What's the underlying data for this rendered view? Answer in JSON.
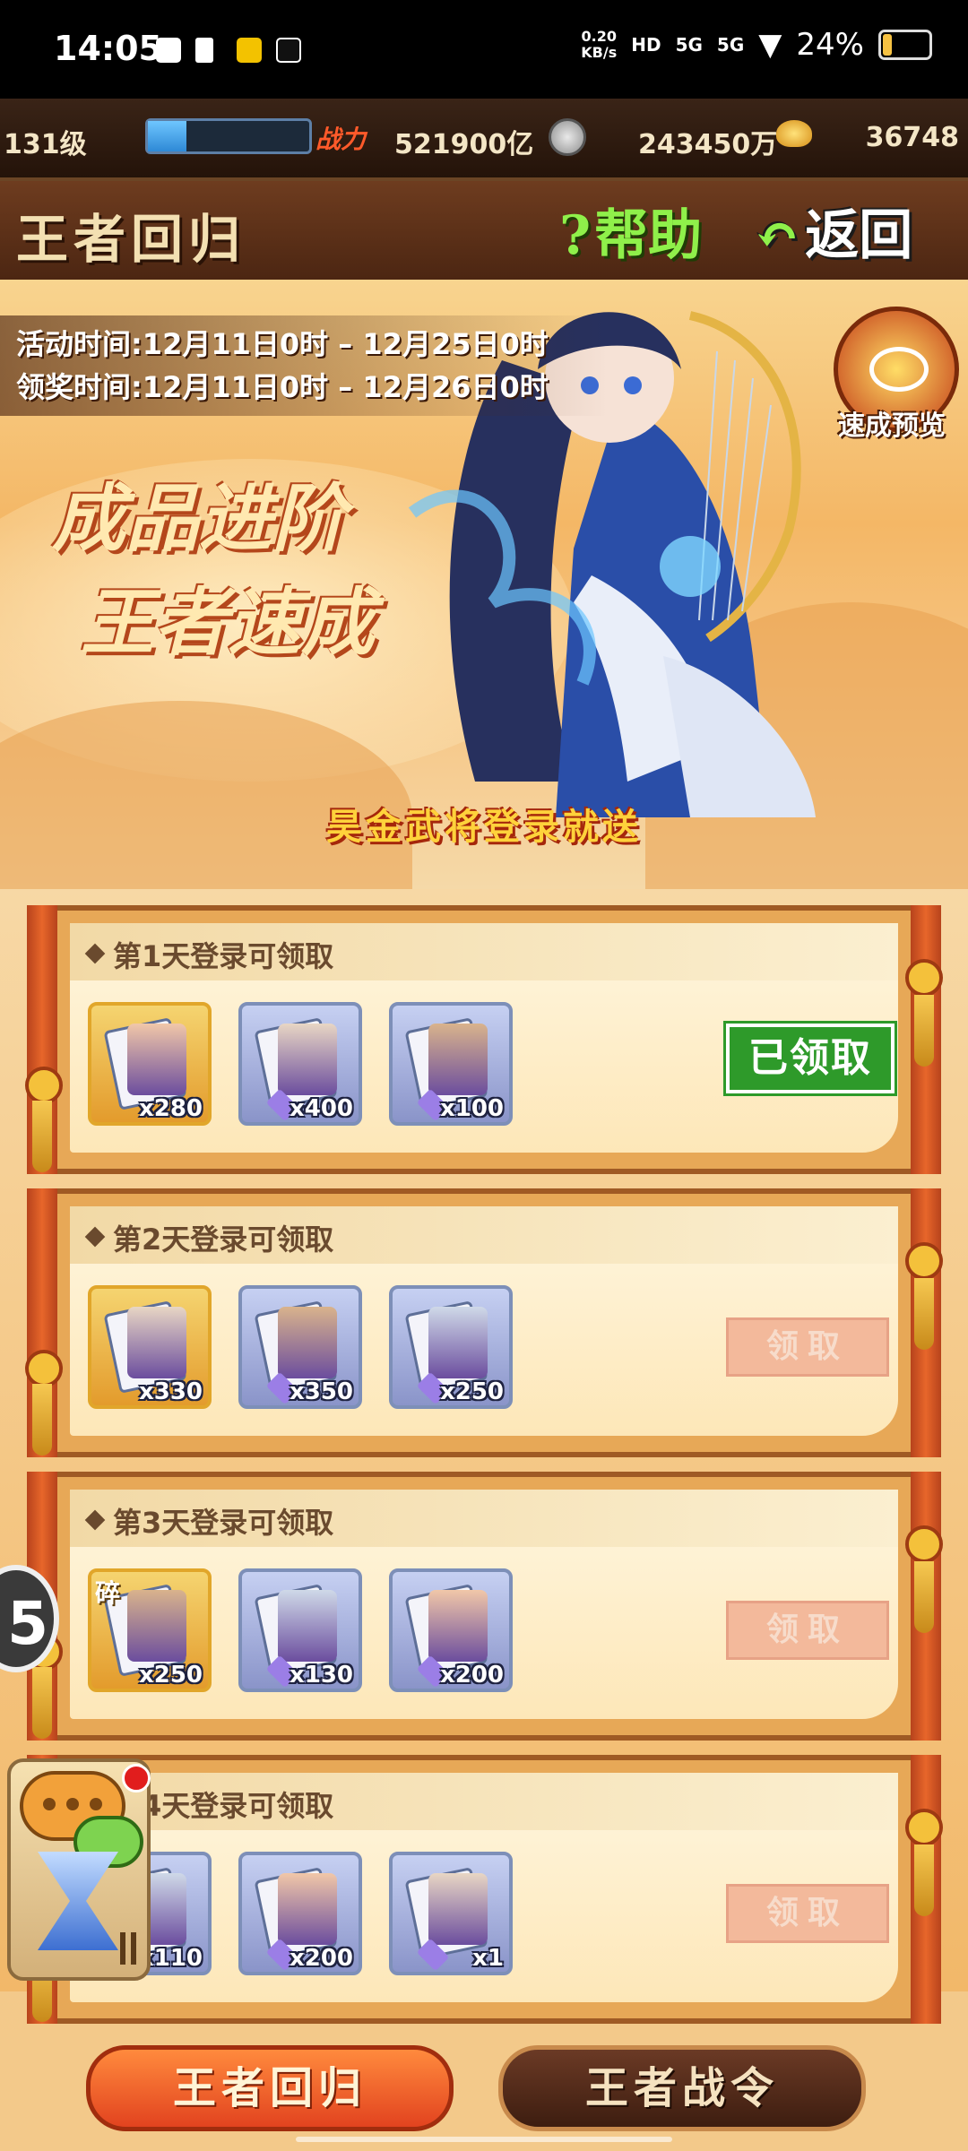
{
  "status_bar": {
    "time": "14:05",
    "speed_value": "0.20",
    "speed_unit": "KB/s",
    "net1": "HD",
    "net2": "5G",
    "net3": "5G",
    "battery": "24%"
  },
  "resources": {
    "level": "131级",
    "power_label": "战力",
    "power_value": "521900亿",
    "silver_value": "243450万",
    "gold_value": "36748",
    "xp_progress": 0.24
  },
  "header": {
    "title": "王者回归",
    "help_label": "帮助",
    "back_label": "返回"
  },
  "banner": {
    "activity_time": "活动时间:12月11日0时 – 12月25日0时",
    "claim_time": "领奖时间:12月11日0时 – 12月26日0时",
    "slogan_line1": "成品进阶",
    "slogan_line2": "王者速成",
    "preview_label": "速成预览",
    "login_send": "昊金武将登录就送"
  },
  "rewards": [
    {
      "title": "第1天登录可领取",
      "items": [
        {
          "count": "x280",
          "type": "gold-hero-card"
        },
        {
          "count": "x400",
          "type": "purple-card"
        },
        {
          "count": "x100",
          "type": "purple-treasure"
        }
      ],
      "button": "已领取",
      "state": "claimed"
    },
    {
      "title": "第2天登录可领取",
      "items": [
        {
          "count": "x330",
          "type": "gold-hero-card"
        },
        {
          "count": "x350",
          "type": "purple-card"
        },
        {
          "count": "x250",
          "type": "purple-card"
        }
      ],
      "button": "领取",
      "state": "locked"
    },
    {
      "title": "第3天登录可领取",
      "items": [
        {
          "count": "x250",
          "type": "gold-hero-fragment",
          "tag": "碎"
        },
        {
          "count": "x130",
          "type": "purple-card"
        },
        {
          "count": "x200",
          "type": "purple-card"
        }
      ],
      "button": "领取",
      "state": "locked"
    },
    {
      "title": "第4天登录可领取",
      "items": [
        {
          "count": "x110",
          "type": "purple-card"
        },
        {
          "count": "x200",
          "type": "purple-card"
        },
        {
          "count": "x1",
          "type": "purple-card"
        }
      ],
      "button": "领取",
      "state": "locked"
    }
  ],
  "float_badge": "5",
  "tabs": [
    {
      "label": "王者回归",
      "active": true
    },
    {
      "label": "王者战令",
      "active": false
    }
  ],
  "colors": {
    "accent": "#e2431f",
    "claimed_green": "#2e9a2a",
    "locked_button": "#f3b99b",
    "frame_red": "#e7662a"
  }
}
